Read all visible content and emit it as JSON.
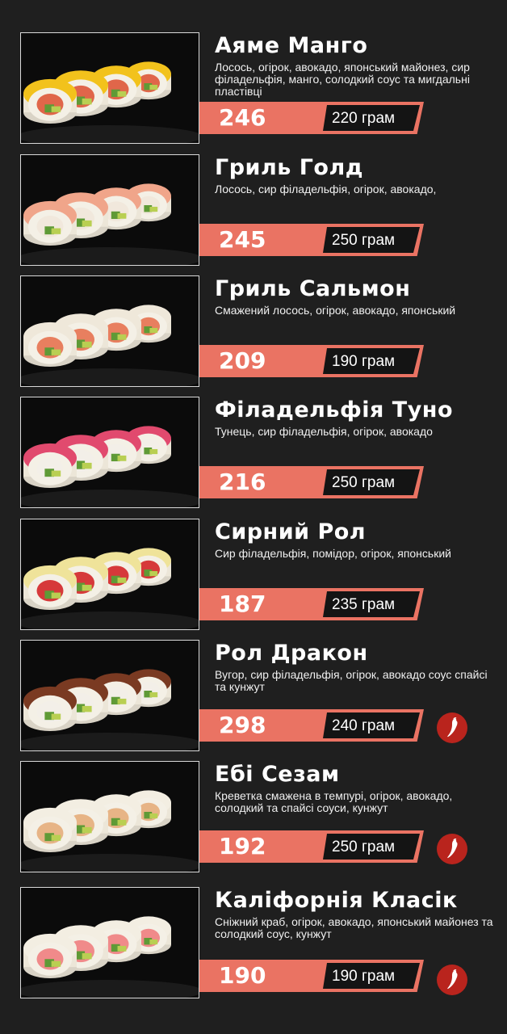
{
  "colors": {
    "background": "#1f1f1f",
    "accent": "#ea7363",
    "weight_box": "#141414",
    "spicy_badge": "#b9241d"
  },
  "menu": {
    "items": [
      {
        "title": "Аяме  Манго",
        "description": "Лосось, огірок, авокадо, японський майонез, сир філадельфія, манго, солодкий соус та мигдальні пластівці",
        "price": "246",
        "weight": "220 грам",
        "spicy": false,
        "photo": "sushi-roll-mango-photo",
        "topping_color": "#f2c21c",
        "filling_color": "#e0664a"
      },
      {
        "title": "Гриль Голд",
        "description": "Лосось, сир філадельфія, огірок, авокадо,",
        "price": "245",
        "weight": "250 грам",
        "spicy": false,
        "photo": "sushi-roll-grilled-salmon-photo",
        "topping_color": "#f0a58a",
        "filling_color": "#f1e8dc"
      },
      {
        "title": "Гриль Сальмон",
        "description": "Смажений лосось, огірок, авокадо, японський",
        "price": "209",
        "weight": "190 грам",
        "spicy": false,
        "photo": "sushi-roll-salmon-sesame-photo",
        "topping_color": "#efe8da",
        "filling_color": "#e87f5f"
      },
      {
        "title": "Філадельфія Туно",
        "description": "Тунець, сир філадельфія, огірок, авокадо",
        "price": "216",
        "weight": "250 грам",
        "spicy": false,
        "photo": "sushi-roll-tuna-photo",
        "topping_color": "#e14a6e",
        "filling_color": "#f3efe8"
      },
      {
        "title": "Сирний Рол",
        "description": "Сир філадельфія, помідор, огірок, японський",
        "price": "187",
        "weight": "235 грам",
        "spicy": false,
        "photo": "sushi-roll-cheese-photo",
        "topping_color": "#efe39a",
        "filling_color": "#d6393a"
      },
      {
        "title": "Рол Дракон",
        "description": "Вугор, сир філадельфія, огірок, авокадо соус спайсі та кунжут",
        "price": "298",
        "weight": "240 грам",
        "spicy": true,
        "photo": "sushi-roll-dragon-photo",
        "topping_color": "#7a3a22",
        "filling_color": "#f3efe8"
      },
      {
        "title": "Ебі Сезам",
        "description": "Креветка смажена в темпурі, огірок, авокадо, солодкий та спайсі соуси, кунжут",
        "price": "192",
        "weight": "250 грам",
        "spicy": true,
        "photo": "sushi-roll-tempura-shrimp-photo",
        "topping_color": "#f3eee2",
        "filling_color": "#e7b486"
      },
      {
        "title": "Каліфорнія Класік",
        "description": "Сніжний краб, огірок, авокадо, японський майонез та  солодкий соус, кунжут",
        "price": "190",
        "weight": "190 грам",
        "spicy": true,
        "photo": "sushi-roll-california-photo",
        "topping_color": "#f3eee2",
        "filling_color": "#f08a8a"
      }
    ]
  }
}
